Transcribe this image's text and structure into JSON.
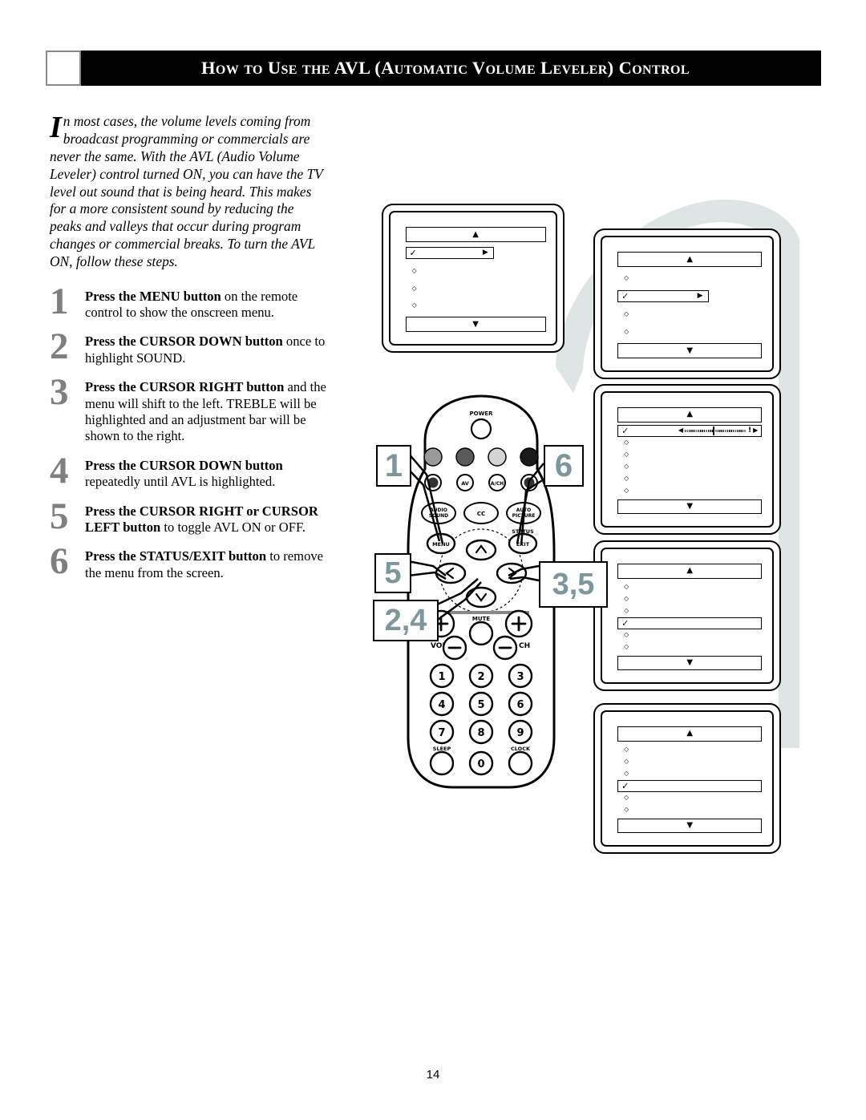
{
  "header": {
    "title": "How to Use the AVL (Automatic Volume Leveler) Control"
  },
  "intro": {
    "dropcap": "I",
    "text": "n most cases, the volume levels coming from broadcast programming or commercials are never the same.  With the AVL (Audio Volume Leveler) control turned ON, you can have the TV level out sound that is being heard.  This makes for a more consistent sound by reducing the peaks and valleys that occur during program changes or commercial breaks.  To turn the AVL ON, follow these steps."
  },
  "steps": [
    {
      "num": "1",
      "bold": "Press the MENU button",
      "rest": " on the remote control to show the onscreen menu."
    },
    {
      "num": "2",
      "bold": "Press the CURSOR DOWN button",
      "rest": " once to highlight SOUND."
    },
    {
      "num": "3",
      "bold": "Press the CURSOR RIGHT button",
      "rest": " and the menu will shift to the left. TREBLE will be highlighted and an adjustment bar will be shown to the right."
    },
    {
      "num": "4",
      "bold": "Press the CURSOR DOWN button",
      "rest": " repeatedly until AVL is highlighted."
    },
    {
      "num": "5",
      "bold": "Press the CURSOR RIGHT or CURSOR LEFT button",
      "rest": " to toggle AVL ON or OFF."
    },
    {
      "num": "6",
      "bold": "Press the STATUS/EXIT button",
      "rest": " to remove the menu from the screen."
    }
  ],
  "callouts": [
    {
      "id": "1",
      "label": "1",
      "target": "menu-button"
    },
    {
      "id": "6",
      "label": "6",
      "target": "status-exit-button"
    },
    {
      "id": "5",
      "label": "5",
      "target": "cursor-left-button"
    },
    {
      "id": "2,4",
      "label": "2,4",
      "target": "cursor-down-button"
    },
    {
      "id": "3,5",
      "label": "3,5",
      "target": "cursor-right-button"
    }
  ],
  "remote": {
    "power_label": "POWER",
    "color_buttons": [
      "#9a9a9a",
      "#5a5a5a",
      "#d4d4d4",
      "#1a1a1a"
    ],
    "icon_row": [
      "smiley",
      "AV",
      "A/CH",
      "smiley2"
    ],
    "feature_row": [
      "AUDIO SOUND",
      "CC",
      "AUTO PICTURE"
    ],
    "menu_label": "MENU",
    "status_label": "STATUS",
    "exit_label": "EXIT",
    "mute_label": "MUTE",
    "vol_label": "VOL",
    "ch_label": "CH",
    "keypad": [
      "1",
      "2",
      "3",
      "4",
      "5",
      "6",
      "7",
      "8",
      "9",
      "0"
    ],
    "sleep_label": "SLEEP",
    "clock_label": "CLOCK"
  },
  "screens": [
    {
      "id": "screen-1",
      "name": "main-menu-picture-highlighted",
      "rows": 4,
      "selected_index": 0,
      "selected_short": true,
      "selected_has_arrow": true,
      "selected_has_slider": false,
      "top_bar": "▲",
      "bottom_bar": "▼",
      "check": "✓",
      "arrow": "▶",
      "bullet": "◇"
    },
    {
      "id": "screen-2",
      "name": "main-menu-sound-highlighted",
      "rows": 4,
      "selected_index": 1,
      "selected_short": true,
      "selected_has_arrow": true,
      "selected_has_slider": false,
      "top_bar": "▲",
      "bottom_bar": "▼",
      "check": "✓",
      "arrow": "▶",
      "bullet": "◇"
    },
    {
      "id": "screen-3",
      "name": "sound-menu-treble-highlighted",
      "rows": 6,
      "selected_index": 0,
      "selected_short": false,
      "selected_has_arrow": false,
      "selected_has_slider": true,
      "top_bar": "▲",
      "bottom_bar": "▼",
      "check": "✓",
      "arrow": "▶",
      "bullet": "◇",
      "slider": {
        "left_arrow": "◀",
        "right_arrow": "▶",
        "marker": "!"
      }
    },
    {
      "id": "screen-4",
      "name": "sound-menu-avl-highlighted",
      "rows": 6,
      "selected_index": 3,
      "selected_short": false,
      "selected_has_arrow": false,
      "selected_has_slider": false,
      "top_bar": "▲",
      "bottom_bar": "▼",
      "check": "✓",
      "arrow": "▶",
      "bullet": "◇"
    },
    {
      "id": "screen-5",
      "name": "sound-menu-avl-toggled",
      "rows": 6,
      "selected_index": 3,
      "selected_short": false,
      "selected_has_arrow": false,
      "selected_has_slider": false,
      "top_bar": "▲",
      "bottom_bar": "▼",
      "check": "✓",
      "arrow": "▶",
      "bullet": "◇"
    }
  ],
  "footer": {
    "page_number": "14"
  },
  "colors": {
    "callout_number": "#7e979c",
    "step_number": "#7f7f7f",
    "swoosh": "#dde5e5",
    "header_bg": "#000000"
  }
}
